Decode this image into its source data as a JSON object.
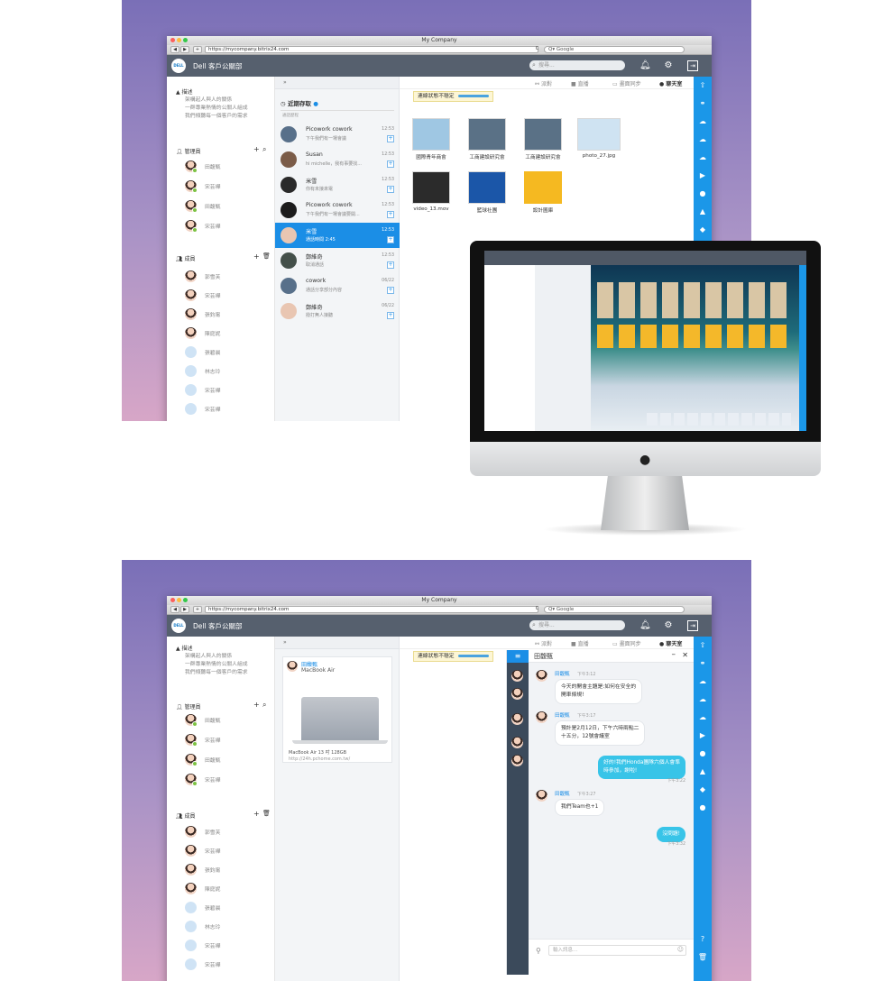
{
  "browser": {
    "window_title": "My Company",
    "url": "https://mycompany.bitrix24.com",
    "search_placeholder": "Q▾ Google",
    "nav_back": "◀",
    "nav_forward": "▶",
    "nav_add": "+",
    "reload": "C"
  },
  "app": {
    "logo_text": "DELL",
    "brand": "Dell 客戶公關部",
    "search_placeholder": "搜尋...",
    "icons": [
      "bell-icon",
      "gear-icon",
      "exit-icon"
    ]
  },
  "left_panel": {
    "description_title": "描述",
    "description_lines": [
      "架構起人與人的關係",
      "一群專業熱情的公關人組成",
      "我們傾聽每一個客戶的需求"
    ],
    "admins_title": "管理員",
    "admins": [
      "田馥甄",
      "宋芸樺",
      "田馥甄",
      "宋芸樺"
    ],
    "members_title": "成員",
    "members": [
      "郭雪芙",
      "宋芸樺",
      "張鈞甯",
      "陳庭妮",
      "張碧晨",
      "林志玲",
      "宋芸樺",
      "宋芸樺"
    ]
  },
  "tabs": {
    "dispatch": "派對",
    "live": "直播",
    "screen_sync": "畫面同步",
    "chat_room": "聊天室"
  },
  "warning": "連線狀態不穩定",
  "recent_list": {
    "title": "近期存取",
    "subtitle": "通話歷程",
    "items": [
      {
        "name": "Picowork cowork",
        "msg": "下午我們有一場會議",
        "time": "12:53"
      },
      {
        "name": "Susan",
        "msg": "hi michelle，我有事要找...",
        "time": "12:53"
      },
      {
        "name": "米雪",
        "msg": "你有未接來電",
        "time": "12:53"
      },
      {
        "name": "Picowork cowork",
        "msg": "下午我們有一場會議要開...",
        "time": "12:53"
      },
      {
        "name": "米雪",
        "msg": "通話時間 2:45",
        "time": "12:53"
      },
      {
        "name": "鄭維奇",
        "msg": "取消通話",
        "time": "12:53"
      },
      {
        "name": "cowork",
        "msg": "通話分享部分內容",
        "time": "06/22"
      },
      {
        "name": "鄭維奇",
        "msg": "撥打無人接聽",
        "time": "06/22"
      }
    ]
  },
  "files": [
    {
      "name": "國際青年商會",
      "color": "#9fc7e3"
    },
    {
      "name": "工商建設研究會",
      "color": "#5a7186"
    },
    {
      "name": "工商建設研究會",
      "color": "#5a7186"
    },
    {
      "name": "photo_27.jpg",
      "color": "#cfe3f2"
    },
    {
      "name": "video_13.mov",
      "color": "#2b2b2b"
    },
    {
      "name": "籃球社團",
      "color": "#1b56a8"
    },
    {
      "name": "設計圖庫",
      "color": "#f5b921"
    }
  ],
  "imac": {
    "apple_logo": ""
  },
  "share_card": {
    "sender": "田馥甄",
    "device": "MacBook Air",
    "product": "MacBook Air 13 吋  128GB",
    "link": "http://24h.pchome.com.tw/"
  },
  "chat": {
    "contact": "田馥甄",
    "input_placeholder": "輸入訊息...",
    "messages": [
      {
        "from": "田馥甄",
        "time": "下午3:12",
        "text_lines": [
          "今天的開會主題是:如何在安全的",
          "開車條規!"
        ]
      },
      {
        "from": "田馥甄",
        "time": "下午3:17",
        "text_lines": [
          "預計是2月12日，下午六時兩點二",
          "十五分，12號會議室"
        ]
      },
      {
        "from": "me",
        "time": "下午3:22",
        "text_lines": [
          "好的!我們Honda團隊六個人會準",
          "時參加，謝啦!"
        ]
      },
      {
        "from": "田馥甄",
        "time": "下午3:27",
        "text_lines": [
          "我們Team也+1"
        ]
      },
      {
        "from": "me",
        "time": "下午3:32",
        "text_lines": [
          "沒問題!"
        ]
      }
    ]
  }
}
